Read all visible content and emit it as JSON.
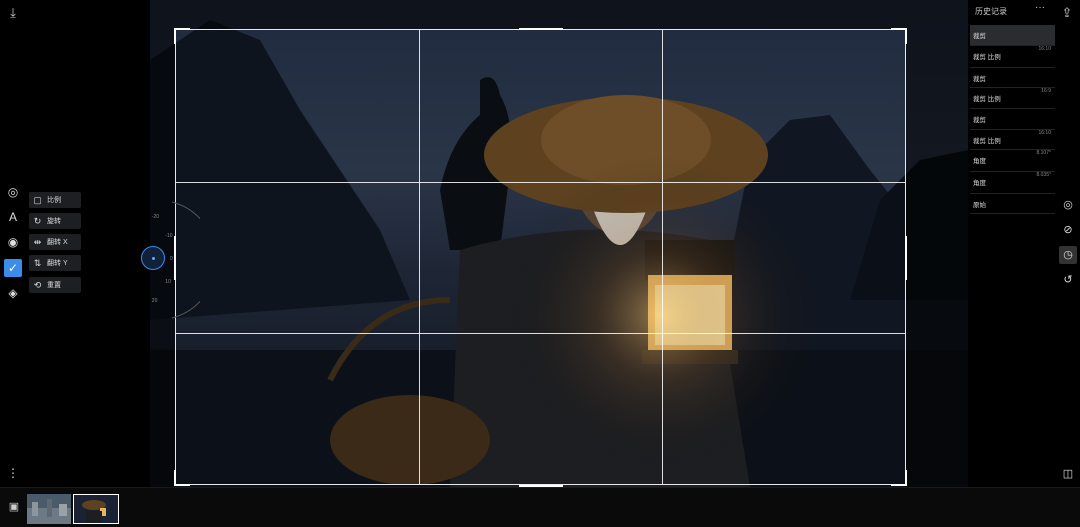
{
  "topbar": {
    "import_icon": "download-icon",
    "export_icon": "share-upload-icon"
  },
  "left_rail": {
    "icons": [
      {
        "name": "adjust-icon",
        "glyph": "◎"
      },
      {
        "name": "text-icon",
        "glyph": "A"
      },
      {
        "name": "mask-icon",
        "glyph": "◉"
      },
      {
        "name": "crop-icon",
        "glyph": "✓",
        "active": true
      },
      {
        "name": "layers-icon",
        "glyph": "◈"
      }
    ],
    "more_glyph": "⋮"
  },
  "tool_menu": {
    "items": [
      {
        "label": "比例",
        "glyph": "▢"
      },
      {
        "label": "旋转",
        "glyph": "↻"
      },
      {
        "label": "翻转 X",
        "glyph": "⇹"
      },
      {
        "label": "翻转 Y",
        "glyph": "⇅"
      },
      {
        "label": "重置",
        "glyph": "⟲"
      }
    ]
  },
  "dial": {
    "ticks": [
      "-30",
      "-20",
      "-10",
      "0",
      "10",
      "20",
      "30"
    ]
  },
  "history": {
    "title": "历史记录",
    "more": "···",
    "rows": [
      {
        "name": "裁剪",
        "value": "",
        "selected": true
      },
      {
        "name": "裁剪 比例",
        "value": "16:10"
      },
      {
        "name": "裁剪",
        "value": ""
      },
      {
        "name": "裁剪 比例",
        "value": "16:9"
      },
      {
        "name": "裁剪",
        "value": ""
      },
      {
        "name": "裁剪 比例",
        "value": "16:10"
      },
      {
        "name": "角度",
        "value": "8.107°"
      },
      {
        "name": "角度",
        "value": "8.035°"
      },
      {
        "name": "原始",
        "value": ""
      }
    ]
  },
  "right_rail": {
    "icons": [
      {
        "name": "filter-icon",
        "glyph": "◎"
      },
      {
        "name": "slash-icon",
        "glyph": "⊘"
      },
      {
        "name": "history-icon",
        "glyph": "◷",
        "active": true
      },
      {
        "name": "undo-icon",
        "glyph": "↺"
      }
    ],
    "compare_glyph": "◫"
  },
  "filmstrip": {
    "gallery_glyph": "▣",
    "thumbs": [
      "city-thumbnail",
      "fisherman-thumbnail"
    ]
  }
}
